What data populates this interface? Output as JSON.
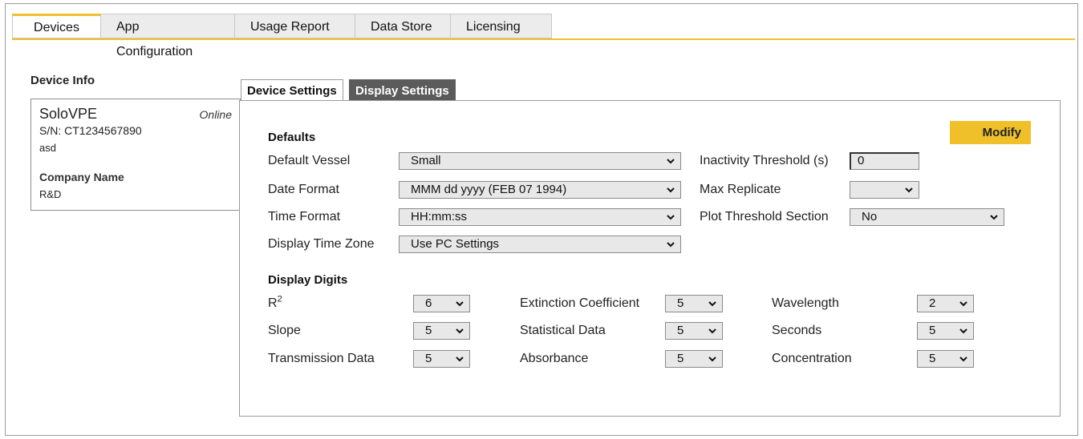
{
  "top_tabs": {
    "devices": "Devices",
    "app_configuration": "App Configuration",
    "usage_report": "Usage Report",
    "data_store": "Data Store",
    "licensing": "Licensing"
  },
  "device_info": {
    "title": "Device Info",
    "name": "SoloVPE",
    "status": "Online",
    "serial": "S/N: CT1234567890",
    "note": "asd",
    "company_label": "Company Name",
    "company_value": "R&D"
  },
  "inner_tabs": {
    "device_settings": "Device Settings",
    "display_settings": "Display Settings"
  },
  "modify_label": "Modify",
  "defaults": {
    "title": "Defaults",
    "default_vessel": {
      "label": "Default Vessel",
      "value": "Small"
    },
    "date_format": {
      "label": "Date Format",
      "value": "MMM dd yyyy (FEB 07 1994)"
    },
    "time_format": {
      "label": "Time Format",
      "value": "HH:mm:ss"
    },
    "display_time_zone": {
      "label": "Display Time Zone",
      "value": "Use PC Settings"
    },
    "inactivity_threshold": {
      "label": "Inactivity Threshold (s)",
      "value": "0"
    },
    "max_replicate": {
      "label": "Max Replicate",
      "value": ""
    },
    "plot_threshold_section": {
      "label": "Plot Threshold Section",
      "value": "No"
    }
  },
  "display_digits": {
    "title": "Display Digits",
    "r2": {
      "label": "R",
      "sup": "2",
      "value": "6"
    },
    "slope": {
      "label": "Slope",
      "value": "5"
    },
    "transmission_data": {
      "label": "Transmission Data",
      "value": "5"
    },
    "extinction_coefficient": {
      "label": "Extinction Coefficient",
      "value": "5"
    },
    "statistical_data": {
      "label": "Statistical Data",
      "value": "5"
    },
    "absorbance": {
      "label": "Absorbance",
      "value": "5"
    },
    "wavelength": {
      "label": "Wavelength",
      "value": "2"
    },
    "seconds": {
      "label": "Seconds",
      "value": "5"
    },
    "concentration": {
      "label": "Concentration",
      "value": "5"
    }
  },
  "colors": {
    "accent": "#f0c02a",
    "active_inner_tab": "#5b5b5b",
    "select_bg": "#e8e8e8"
  },
  "icons": {
    "dropdown": "chevron-down-icon"
  }
}
